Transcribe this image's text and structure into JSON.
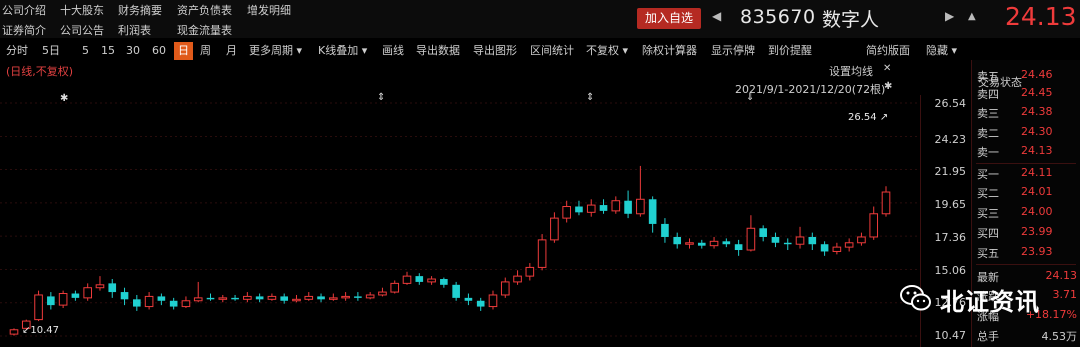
{
  "top_links": {
    "row1": [
      "公司介绍",
      "十大股东",
      "财务摘要",
      "资产负债表",
      "增发明细"
    ],
    "row2": [
      "证券简介",
      "公司公告",
      "利润表",
      "现金流量表"
    ]
  },
  "header": {
    "add_favorite": "加入自选",
    "code": "835670",
    "name": "数字人",
    "price": "24.13"
  },
  "toolbar": {
    "items": [
      "分时",
      "5日",
      "5",
      "15",
      "30",
      "60",
      "日",
      "周",
      "月",
      "更多周期",
      "K线叠加",
      "画线",
      "导出数据",
      "导出图形",
      "区间统计",
      "不复权",
      "除权计算器",
      "显示停牌",
      "到价提醒"
    ],
    "active": "日",
    "simple_layout": "简约版面",
    "hide": "隐藏"
  },
  "chart": {
    "mode_label": "(日线,不复权)",
    "ma_settings": "设置均线",
    "range": "2021/9/1-2021/12/20(72根)",
    "high_label": "26.54",
    "low_label": "10.47",
    "yaxis": [
      "26.54",
      "24.23",
      "21.95",
      "19.65",
      "17.36",
      "15.06",
      "12.76",
      "10.47"
    ]
  },
  "chart_data": {
    "type": "candlestick",
    "period": "2021/9/1-2021/12/20",
    "count": 72,
    "y_range": [
      10.47,
      26.54
    ],
    "y_ticks": [
      26.54,
      24.23,
      21.95,
      19.65,
      17.36,
      15.06,
      12.76,
      10.47
    ],
    "candles": [
      [
        10.6,
        10.9,
        10.5,
        11.0
      ],
      [
        11.0,
        11.5,
        10.9,
        11.6
      ],
      [
        11.6,
        13.3,
        11.5,
        13.6
      ],
      [
        13.2,
        12.6,
        12.3,
        13.5
      ],
      [
        12.6,
        13.4,
        12.4,
        13.6
      ],
      [
        13.4,
        13.1,
        12.9,
        13.6
      ],
      [
        13.1,
        13.8,
        12.9,
        14.1
      ],
      [
        13.8,
        14.0,
        13.6,
        14.6
      ],
      [
        14.1,
        13.5,
        13.1,
        14.4
      ],
      [
        13.5,
        13.0,
        12.6,
        13.8
      ],
      [
        13.0,
        12.5,
        12.2,
        13.3
      ],
      [
        12.5,
        13.2,
        12.3,
        13.5
      ],
      [
        13.2,
        12.9,
        12.6,
        13.4
      ],
      [
        12.9,
        12.5,
        12.3,
        13.1
      ],
      [
        12.5,
        12.9,
        12.4,
        13.2
      ],
      [
        12.9,
        13.1,
        12.8,
        14.2
      ],
      [
        13.1,
        13.0,
        12.9,
        13.4
      ],
      [
        13.0,
        13.1,
        12.8,
        13.3
      ],
      [
        13.1,
        13.0,
        12.9,
        13.3
      ],
      [
        13.0,
        13.2,
        12.8,
        13.5
      ],
      [
        13.2,
        13.0,
        12.8,
        13.4
      ],
      [
        13.0,
        13.2,
        12.9,
        13.4
      ],
      [
        13.2,
        12.9,
        12.7,
        13.4
      ],
      [
        12.9,
        13.0,
        12.8,
        13.3
      ],
      [
        13.0,
        13.2,
        12.9,
        13.5
      ],
      [
        13.2,
        13.0,
        12.8,
        13.4
      ],
      [
        13.0,
        13.1,
        12.9,
        13.4
      ],
      [
        13.1,
        13.2,
        12.9,
        13.5
      ],
      [
        13.2,
        13.1,
        12.9,
        13.5
      ],
      [
        13.1,
        13.3,
        13.0,
        13.5
      ],
      [
        13.3,
        13.5,
        13.2,
        13.8
      ],
      [
        13.5,
        14.1,
        13.4,
        14.3
      ],
      [
        14.1,
        14.6,
        14.0,
        14.9
      ],
      [
        14.6,
        14.2,
        14.0,
        14.8
      ],
      [
        14.2,
        14.4,
        14.0,
        14.6
      ],
      [
        14.4,
        14.0,
        13.8,
        14.5
      ],
      [
        14.0,
        13.1,
        12.9,
        14.2
      ],
      [
        13.1,
        12.9,
        12.6,
        13.4
      ],
      [
        12.9,
        12.5,
        12.2,
        13.1
      ],
      [
        12.5,
        13.3,
        12.3,
        13.6
      ],
      [
        13.3,
        14.2,
        13.1,
        14.5
      ],
      [
        14.2,
        14.6,
        14.0,
        15.0
      ],
      [
        14.6,
        15.2,
        14.3,
        15.5
      ],
      [
        15.2,
        17.1,
        15.0,
        17.5
      ],
      [
        17.1,
        18.6,
        16.9,
        19.0
      ],
      [
        18.6,
        19.4,
        18.3,
        19.8
      ],
      [
        19.4,
        19.0,
        18.8,
        19.8
      ],
      [
        19.0,
        19.5,
        18.7,
        19.9
      ],
      [
        19.5,
        19.1,
        18.9,
        19.9
      ],
      [
        19.1,
        19.8,
        18.9,
        20.1
      ],
      [
        19.8,
        18.9,
        18.6,
        20.5
      ],
      [
        18.9,
        19.9,
        18.7,
        22.2
      ],
      [
        19.9,
        18.2,
        17.6,
        20.1
      ],
      [
        18.2,
        17.3,
        16.9,
        18.6
      ],
      [
        17.3,
        16.8,
        16.5,
        17.6
      ],
      [
        16.8,
        16.9,
        16.5,
        17.2
      ],
      [
        16.9,
        16.7,
        16.5,
        17.1
      ],
      [
        16.7,
        17.0,
        16.5,
        17.3
      ],
      [
        17.0,
        16.8,
        16.6,
        17.2
      ],
      [
        16.8,
        16.4,
        16.0,
        17.1
      ],
      [
        16.4,
        17.9,
        16.3,
        18.8
      ],
      [
        17.9,
        17.3,
        17.0,
        18.1
      ],
      [
        17.3,
        16.9,
        16.6,
        17.6
      ],
      [
        16.9,
        16.8,
        16.4,
        17.2
      ],
      [
        16.8,
        17.3,
        16.5,
        18.0
      ],
      [
        17.3,
        16.8,
        16.4,
        17.6
      ],
      [
        16.8,
        16.3,
        16.0,
        17.0
      ],
      [
        16.3,
        16.6,
        16.1,
        16.9
      ],
      [
        16.6,
        16.9,
        16.3,
        17.2
      ],
      [
        16.9,
        17.3,
        16.7,
        17.6
      ],
      [
        17.3,
        18.9,
        17.1,
        19.4
      ],
      [
        18.9,
        20.4,
        18.7,
        20.8
      ]
    ]
  },
  "orderbook": {
    "title": "交易状态",
    "asks": [
      {
        "label": "卖五",
        "price": "24.46"
      },
      {
        "label": "卖四",
        "price": "24.45"
      },
      {
        "label": "卖三",
        "price": "24.38"
      },
      {
        "label": "卖二",
        "price": "24.30"
      },
      {
        "label": "卖一",
        "price": "24.13"
      }
    ],
    "bids": [
      {
        "label": "买一",
        "price": "24.11"
      },
      {
        "label": "买二",
        "price": "24.01"
      },
      {
        "label": "买三",
        "price": "24.00"
      },
      {
        "label": "买四",
        "price": "23.99"
      },
      {
        "label": "买五",
        "price": "23.93"
      }
    ],
    "stats": {
      "latest_label": "最新",
      "latest": "24.13",
      "change_label": "涨跌",
      "change": "3.71",
      "pct_label": "涨幅",
      "pct": "+18.17%",
      "vol_label": "总手",
      "vol": "4.53万"
    }
  },
  "watermark": {
    "text": "北证资讯"
  },
  "colors": {
    "up": "#ef3b3b",
    "down": "#20d0d0",
    "accent": "#e05a1a"
  }
}
